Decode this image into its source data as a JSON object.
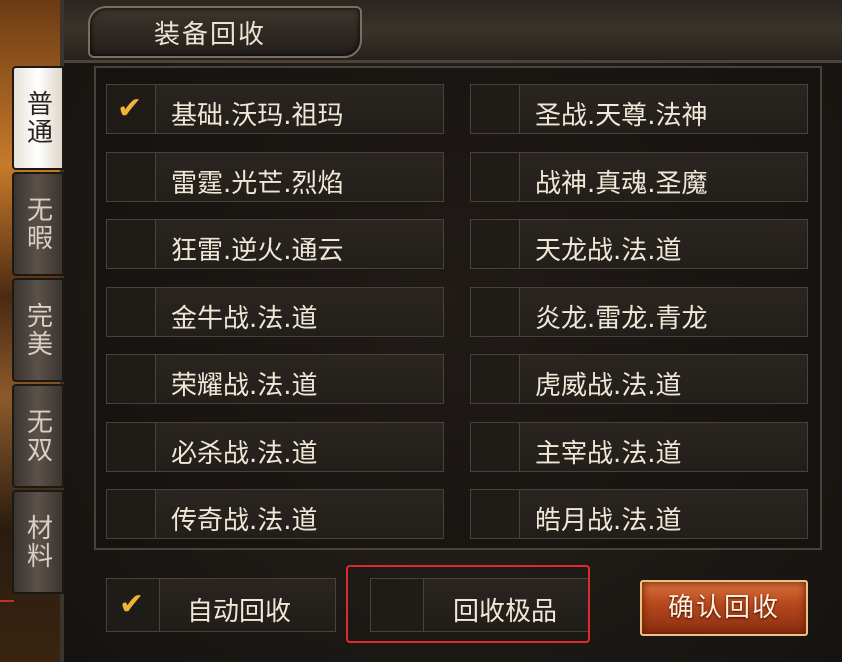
{
  "panel": {
    "title": "装备回收"
  },
  "tabs": [
    {
      "label": "普通",
      "active": true
    },
    {
      "label": "无暇",
      "active": false
    },
    {
      "label": "完美",
      "active": false
    },
    {
      "label": "无双",
      "active": false
    },
    {
      "label": "材料",
      "active": false
    }
  ],
  "left_column": [
    {
      "label": "基础.沃玛.祖玛",
      "checked": true
    },
    {
      "label": "雷霆.光芒.烈焰",
      "checked": false
    },
    {
      "label": "狂雷.逆火.通云",
      "checked": false
    },
    {
      "label": "金牛战.法.道",
      "checked": false
    },
    {
      "label": "荣耀战.法.道",
      "checked": false
    },
    {
      "label": "必杀战.法.道",
      "checked": false
    },
    {
      "label": "传奇战.法.道",
      "checked": false
    }
  ],
  "right_column": [
    {
      "label": "圣战.天尊.法神",
      "checked": false
    },
    {
      "label": "战神.真魂.圣魔",
      "checked": false
    },
    {
      "label": "天龙战.法.道",
      "checked": false
    },
    {
      "label": "炎龙.雷龙.青龙",
      "checked": false
    },
    {
      "label": "虎威战.法.道",
      "checked": false
    },
    {
      "label": "主宰战.法.道",
      "checked": false
    },
    {
      "label": "皓月战.法.道",
      "checked": false
    }
  ],
  "bottom": {
    "auto_recycle": {
      "label": "自动回收",
      "checked": true
    },
    "recycle_rare": {
      "label": "回收极品",
      "checked": false
    },
    "confirm_label": "确认回收"
  },
  "icons": {
    "check": "checkmark-icon"
  },
  "colors": {
    "check": "#f2b33a",
    "highlight": "#e02a2a",
    "confirm": "#b3461c"
  }
}
